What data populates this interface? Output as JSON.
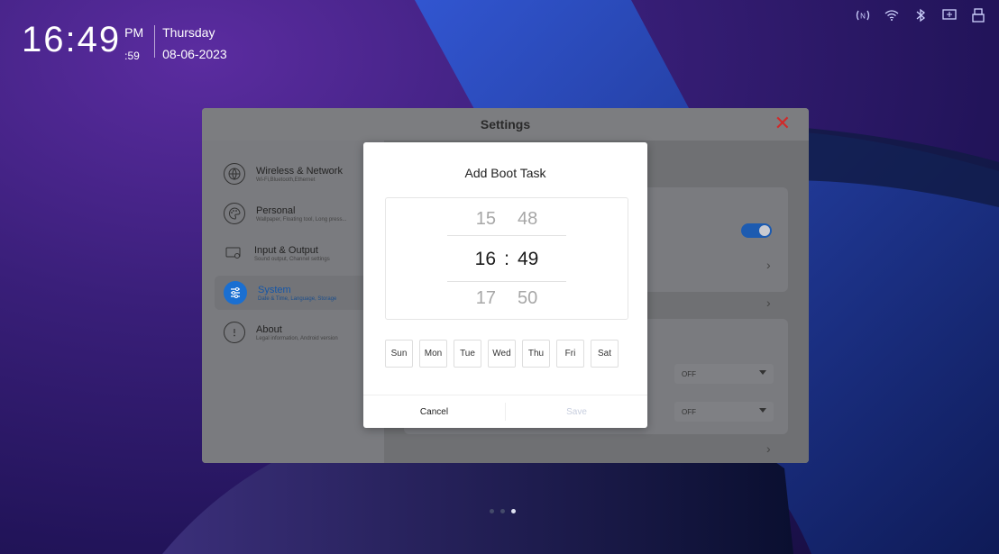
{
  "clock": {
    "time": "16:49",
    "ampm": "PM",
    "seconds": ":59",
    "day": "Thursday",
    "date": "08-06-2023"
  },
  "status_icons": [
    "nfc-icon",
    "wifi-icon",
    "bluetooth-icon",
    "screen-cast-icon",
    "usb-icon"
  ],
  "settings": {
    "title": "Settings",
    "sidebar": [
      {
        "label": "Wireless & Network",
        "sub": "Wi-Fi,Bluetooth,Ethernet",
        "icon": "globe-icon",
        "active": false
      },
      {
        "label": "Personal",
        "sub": "Wallpaper, Floating tool, Long press...",
        "icon": "palette-icon",
        "active": false
      },
      {
        "label": "Input & Output",
        "sub": "Sound output, Channel settings",
        "icon": "display-icon",
        "active": false
      },
      {
        "label": "System",
        "sub": "Date & Time, Language, Storage",
        "icon": "sliders-icon",
        "active": true
      },
      {
        "label": "About",
        "sub": "Legal information, Android version",
        "icon": "info-icon",
        "active": false
      }
    ],
    "main": {
      "dropdown1_value": "OFF",
      "dropdown2_value": "OFF",
      "toggle_on": true
    }
  },
  "modal": {
    "title": "Add Boot Task",
    "picker": {
      "prev_hour": "15",
      "prev_minute": "48",
      "hour": "16",
      "separator": ":",
      "minute": "49",
      "next_hour": "17",
      "next_minute": "50"
    },
    "days": [
      "Sun",
      "Mon",
      "Tue",
      "Wed",
      "Thu",
      "Fri",
      "Sat"
    ],
    "cancel_label": "Cancel",
    "save_label": "Save"
  },
  "colors": {
    "accent": "#1a6fd1",
    "close": "#d02a2a"
  },
  "page_indicator": {
    "count": 3,
    "active_index": 2
  }
}
